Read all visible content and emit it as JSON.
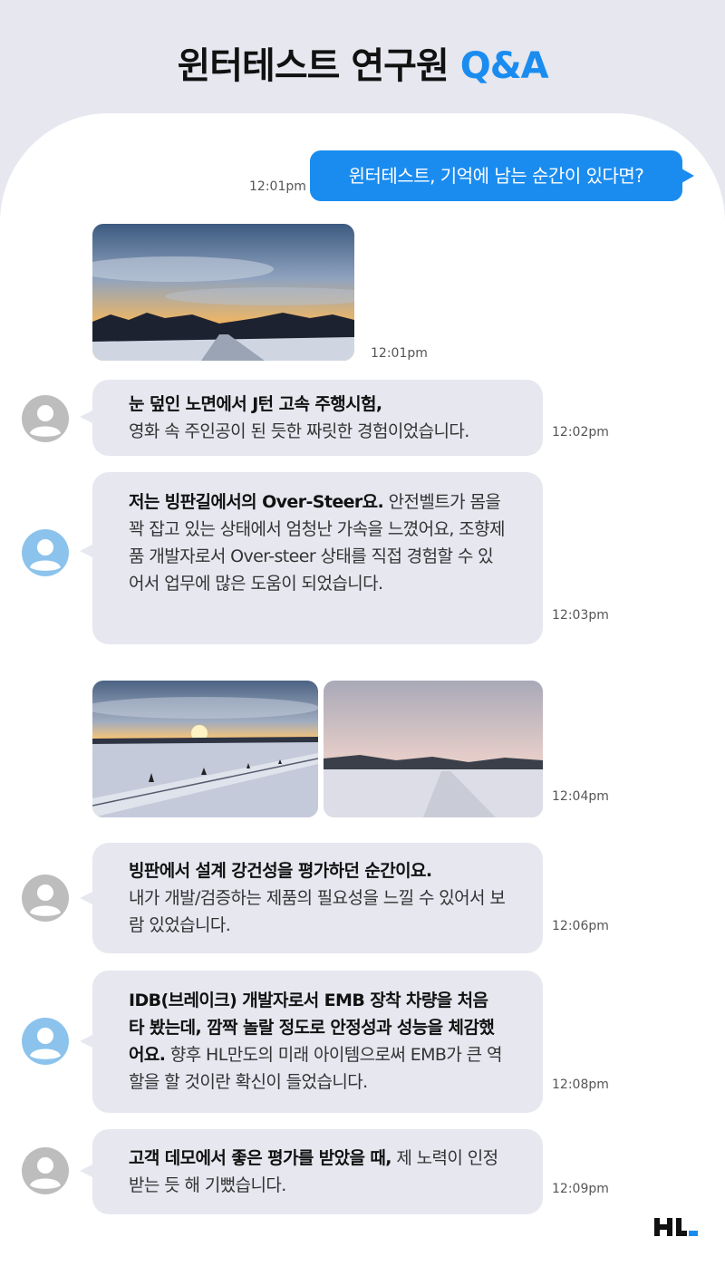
{
  "header": {
    "title": "윈터테스트 연구원",
    "title_accent": "Q&A",
    "accent_color": "#1a8cf0"
  },
  "question": {
    "text": "윈터테스트, 기억에 남는 순간이 있다면?",
    "time": "12:01pm"
  },
  "photo1": {
    "time": "12:01pm",
    "description_icon": "winter-road-sunset-photo"
  },
  "answers": [
    {
      "bold": "눈 덮인 노면에서 J턴 고속 주행시험,",
      "rest": "영화 속 주인공이 된 듯한 짜릿한 경험이었습니다.",
      "time": "12:02pm",
      "avatar_color": "gray"
    },
    {
      "bold": "저는 빙판길에서의 Over-Steer요.",
      "rest": " 안전벨트가 몸을 꽉 잡고 있는 상태에서 엄청난 가속을 느꼈어요, 조향제품 개발자로서 Over-steer 상태를 직접 경험할 수 있어서 업무에 많은 도움이 되었습니다.",
      "time": "12:03pm",
      "avatar_color": "blue"
    },
    {
      "bold": "빙판에서 설계 강건성을 평가하던 순간이요.",
      "rest": "내가 개발/검증하는 제품의 필요성을 느낄 수 있어서 보람 있었습니다.",
      "time": "12:06pm",
      "avatar_color": "gray"
    },
    {
      "bold": "IDB(브레이크) 개발자로서 EMB 장착 차량을 처음 타 봤는데, 깜짝 놀랄 정도로 안정성과 성능을 체감했어요.",
      "rest": " 향후 HL만도의 미래 아이템으로써 EMB가 큰 역할을 할 것이란 확신이 들었습니다.",
      "time": "12:08pm",
      "avatar_color": "blue"
    },
    {
      "bold": "고객 데모에서 좋은 평가를 받았을 때,",
      "rest": " 제 노력이 인정받는 듯 해 기뻤습니다.",
      "time": "12:09pm",
      "avatar_color": "gray"
    }
  ],
  "photos2": {
    "time": "12:04pm"
  },
  "logo": {
    "text": "HL"
  }
}
